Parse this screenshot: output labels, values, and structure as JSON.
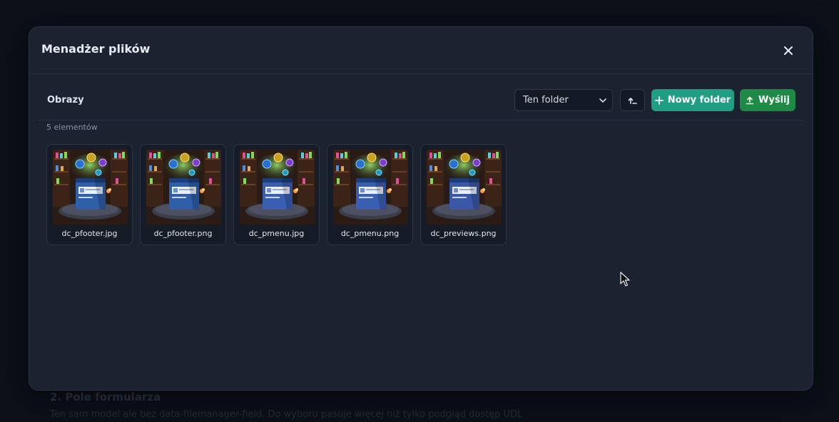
{
  "background": {
    "heading": "2. Pole formularza",
    "paragraph": "Ten sam model ale bez data-filemanager-field. Do wyboru pasuje więcej niż tylko podgląd dostęp UDL"
  },
  "modal": {
    "title": "Menadżer plików",
    "close_icon": "close-icon"
  },
  "toolbar": {
    "current_folder": "Obrazy",
    "scope_select": {
      "selected": "Ten folder"
    },
    "up_icon": "arrow-up-icon",
    "new_folder_label": "Nowy folder",
    "upload_label": "Wyślij"
  },
  "listing": {
    "count_label": "5 elementów",
    "files": [
      {
        "name": "dc_pfooter.jpg",
        "accent": "#2f5fa8"
      },
      {
        "name": "dc_pfooter.png",
        "accent": "#2f5fa8"
      },
      {
        "name": "dc_pmenu.jpg",
        "accent": "#3a5fb0"
      },
      {
        "name": "dc_pmenu.png",
        "accent": "#3a5fb0"
      },
      {
        "name": "dc_previews.png",
        "accent": "#3b58a8"
      }
    ]
  },
  "colors": {
    "accent_teal": "#1f9e83",
    "accent_green": "#1d8a46"
  }
}
